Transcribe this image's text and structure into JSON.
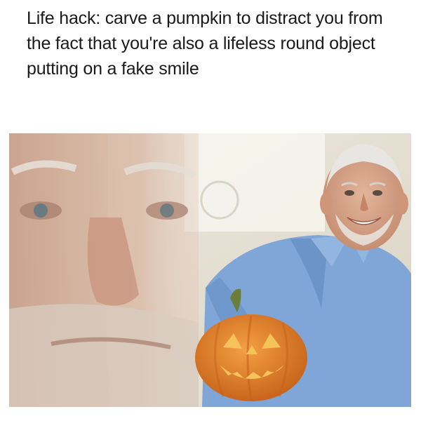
{
  "meme": {
    "caption": "Life hack: carve a pumpkin to distract you from the fact that you're also a lifeless round object putting on a fake smile"
  },
  "photo": {
    "subject": "smiling elderly man in blue shirt holding carved jack-o-lantern, with a faded close-up of his face overlaid on the left",
    "colors": {
      "background_wall": "#e8e4d8",
      "shirt": "#7fa6d6",
      "skin": "#d9a488",
      "pumpkin": "#e8832a",
      "pumpkin_cut": "#f6c25a"
    }
  }
}
